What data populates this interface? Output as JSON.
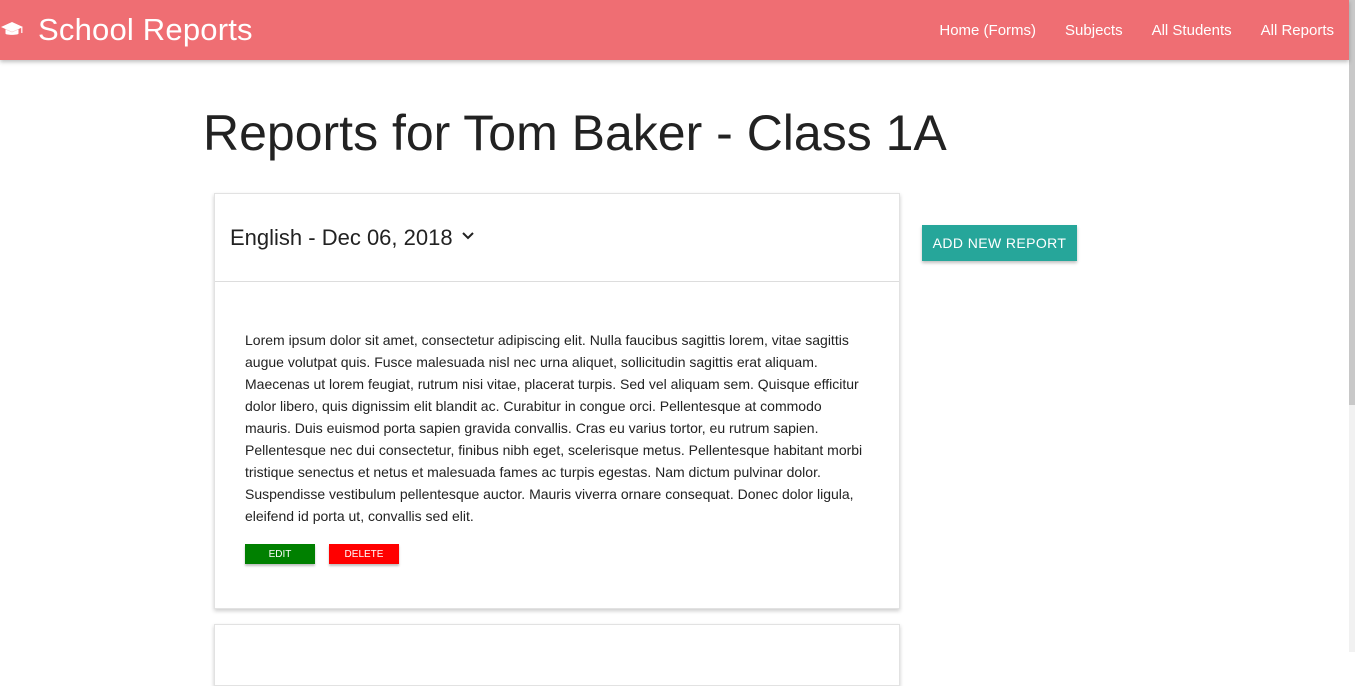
{
  "navbar": {
    "brand": "School Reports",
    "brand_icon": "graduation-cap-icon",
    "background": "#ef6e73",
    "links": [
      "Home (Forms)",
      "Subjects",
      "All Students",
      "All Reports"
    ]
  },
  "page": {
    "title": "Reports for Tom Baker - Class 1A"
  },
  "reports": [
    {
      "header": "English - Dec 06, 2018",
      "expand_icon": "chevron-down-icon",
      "body": "Lorem ipsum dolor sit amet, consectetur adipiscing elit. Nulla faucibus sagittis lorem, vitae sagittis augue volutpat quis. Fusce malesuada nisl nec urna aliquet, sollicitudin sagittis erat aliquam. Maecenas ut lorem feugiat, rutrum nisi vitae, placerat turpis. Sed vel aliquam sem. Quisque efficitur dolor libero, quis dignissim elit blandit ac. Curabitur in congue orci. Pellentesque at commodo mauris. Duis euismod porta sapien gravida convallis. Cras eu varius tortor, eu rutrum sapien. Pellentesque nec dui consectetur, finibus nibh eget, scelerisque metus. Pellentesque habitant morbi tristique senectus et netus et malesuada fames ac turpis egestas. Nam dictum pulvinar dolor. Suspendisse vestibulum pellentesque auctor. Mauris viverra ornare consequat. Donec dolor ligula, eleifend id porta ut, convallis sed elit.",
      "edit_label": "Edit",
      "delete_label": "Delete"
    }
  ],
  "actions": {
    "add_report_label": "Add New Report"
  },
  "colors": {
    "accent": "#26a69a",
    "edit": "#008000",
    "delete": "#ff0000"
  }
}
